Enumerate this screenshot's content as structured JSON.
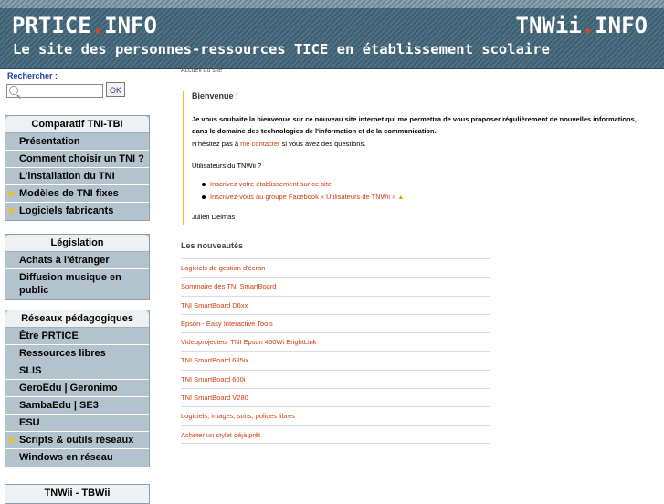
{
  "header": {
    "logo_left_a": "PRTICE",
    "logo_left_dot": ".",
    "logo_left_b": "INFO",
    "logo_right_a": "TNWii",
    "logo_right_dot": ".",
    "logo_right_b": "INFO",
    "tagline": "Le site des personnes-ressources TICE en établissement scolaire"
  },
  "search": {
    "label": "Rechercher :",
    "button": "OK",
    "value": ""
  },
  "sidebar": {
    "box1": {
      "title": "Comparatif TNI-TBI",
      "items": [
        "Présentation",
        "Comment choisir un TNI ?",
        "L'installation du TNI",
        "Modèles de TNI fixes",
        "Logiciels fabricants"
      ]
    },
    "box2": {
      "title": "Législation",
      "items": [
        "Achats à l'étranger",
        "Diffusion musique en public"
      ]
    },
    "box3": {
      "title": "Réseaux pédagogiques",
      "items": [
        "Être PRTICE",
        "Ressources libres",
        "SLIS",
        "GeroEdu | Geronimo",
        "SambaEdu | SE3",
        "ESU",
        "Scripts & outils réseaux",
        "Windows en réseau"
      ]
    },
    "box4": {
      "title": "TNWii - TBWii"
    }
  },
  "content": {
    "breadcrumb": "Accueil du site",
    "welcome_title": "Bienvenue !",
    "welcome_p1": "Je vous souhaite la bienvenue sur ce nouveau site internet qui me permettra de vous proposer régulièrement de nouvelles informations, dans le domaine des technologies de l'information et de la communication.",
    "welcome_p2_a": "N'hésitez pas à ",
    "welcome_p2_link": "me contacter",
    "welcome_p2_b": " si vous avez des questions.",
    "welcome_p3": "Utilisateurs du TNWii ?",
    "welcome_links": [
      "Inscrivez votre établissement sur ce site",
      "Inscrivez-vous au groupe Facebook « Utilisateurs de TNWii »"
    ],
    "signature": "Julien Delmas",
    "news_title": "Les nouveautés",
    "news": [
      "Logiciels de gestion d'écran",
      "Sommaire des TNI SmartBoard",
      "TNI SmartBoard D6xx",
      "Epson - Easy Interactive Tools",
      "Videoprojecteur TNI Epson 450Wi BrightLink",
      "TNI SmartBoard 685ix",
      "TNI SmartBoard 600i",
      "TNI SmartBoard V280",
      "Logiciels, images, sons, polices libres",
      "Acheter un stylet déjà prêt"
    ]
  }
}
